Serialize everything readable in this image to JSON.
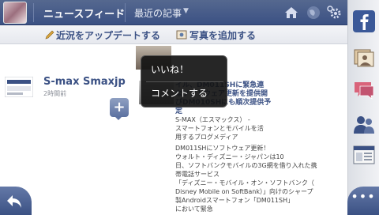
{
  "header": {
    "title": "ニュースフィード",
    "filter_label": "最近の記事"
  },
  "composer": {
    "status_label": "近況をアップデートする",
    "photo_label": "写真を追加する"
  },
  "story": {
    "name": "S-max Smaxjp",
    "time": "2時間前",
    "link_title_lines": [
      "イル、DM011SHに緊急連",
      "なソフトウェア更新を提供開",
      "びDM010SHにも順次提供予",
      "定"
    ],
    "desc_lines": [
      "S-MAX（エスマックス） -",
      "スマートフォンとモバイルを活",
      "用するブログメディア",
      "DM011SHにソフトウェア更新！",
      "ウォルト・ディズニー・ジャパンは10",
      "日、ソフトバンクモバイルの3G網を借り入れた携",
      "帯電話サービス",
      "「ディズニー・モバイル・オン・ソフトバンク（",
      "Disney Mobile on SoftBank）」向けのシャープ",
      "製Androidスマートフォン「DM011SH」",
      "において緊急"
    ]
  },
  "popup": {
    "like_label": "いいね！",
    "comment_label": "コメントする"
  },
  "bottom": {
    "more_label": "•••"
  },
  "colors": {
    "brand": "#3b5184",
    "link": "#3b5184"
  },
  "icons": {
    "home": "home-icon",
    "notifications": "globe-icon",
    "settings": "gear-icon",
    "facebook": "facebook-icon",
    "photos": "photos-icon",
    "messages": "chat-icon",
    "friends": "friends-icon",
    "pages": "pages-icon",
    "back": "back-arrow-icon"
  }
}
